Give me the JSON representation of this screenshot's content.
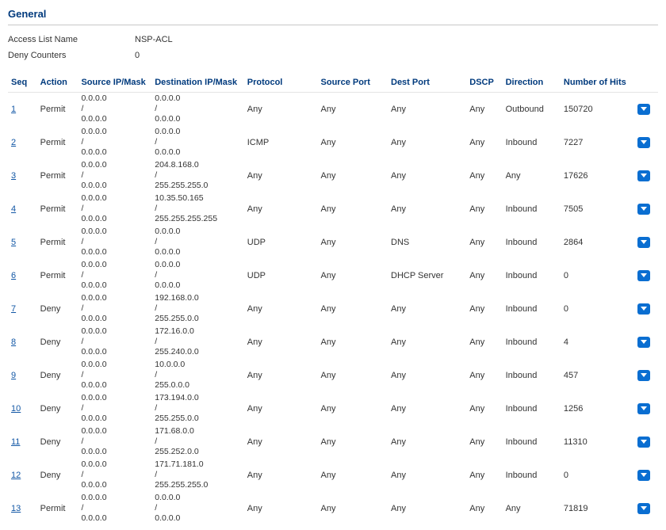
{
  "section_title": "General",
  "kv": {
    "name_label": "Access List Name",
    "name_value": "NSP-ACL",
    "deny_label": "Deny Counters",
    "deny_value": "0"
  },
  "columns": {
    "seq": "Seq",
    "action": "Action",
    "source_ip": "Source IP/Mask",
    "dest_ip": "Destination IP/Mask",
    "protocol": "Protocol",
    "source_port": "Source Port",
    "dest_port": "Dest Port",
    "dscp": "DSCP",
    "direction": "Direction",
    "hits": "Number of Hits"
  },
  "rows": [
    {
      "seq": "1",
      "action": "Permit",
      "sip_ip": "0.0.0.0",
      "sip_sep": "/",
      "sip_mask": "0.0.0.0",
      "dip_ip": "0.0.0.0",
      "dip_sep": "/",
      "dip_mask": "0.0.0.0",
      "protocol": "Any",
      "sport": "Any",
      "dport": "Any",
      "dscp": "Any",
      "direction": "Outbound",
      "hits": "150720"
    },
    {
      "seq": "2",
      "action": "Permit",
      "sip_ip": "0.0.0.0",
      "sip_sep": "/",
      "sip_mask": "0.0.0.0",
      "dip_ip": "0.0.0.0",
      "dip_sep": "/",
      "dip_mask": "0.0.0.0",
      "protocol": "ICMP",
      "sport": "Any",
      "dport": "Any",
      "dscp": "Any",
      "direction": "Inbound",
      "hits": "7227"
    },
    {
      "seq": "3",
      "action": "Permit",
      "sip_ip": "0.0.0.0",
      "sip_sep": "/",
      "sip_mask": "0.0.0.0",
      "dip_ip": "204.8.168.0",
      "dip_sep": "/",
      "dip_mask": "255.255.255.0",
      "protocol": "Any",
      "sport": "Any",
      "dport": "Any",
      "dscp": "Any",
      "direction": "Any",
      "hits": "17626"
    },
    {
      "seq": "4",
      "action": "Permit",
      "sip_ip": "0.0.0.0",
      "sip_sep": "/",
      "sip_mask": "0.0.0.0",
      "dip_ip": "10.35.50.165",
      "dip_sep": "/",
      "dip_mask": "255.255.255.255",
      "protocol": "Any",
      "sport": "Any",
      "dport": "Any",
      "dscp": "Any",
      "direction": "Inbound",
      "hits": "7505"
    },
    {
      "seq": "5",
      "action": "Permit",
      "sip_ip": "0.0.0.0",
      "sip_sep": "/",
      "sip_mask": "0.0.0.0",
      "dip_ip": "0.0.0.0",
      "dip_sep": "/",
      "dip_mask": "0.0.0.0",
      "protocol": "UDP",
      "sport": "Any",
      "dport": "DNS",
      "dscp": "Any",
      "direction": "Inbound",
      "hits": "2864"
    },
    {
      "seq": "6",
      "action": "Permit",
      "sip_ip": "0.0.0.0",
      "sip_sep": "/",
      "sip_mask": "0.0.0.0",
      "dip_ip": "0.0.0.0",
      "dip_sep": "/",
      "dip_mask": "0.0.0.0",
      "protocol": "UDP",
      "sport": "Any",
      "dport": "DHCP Server",
      "dscp": "Any",
      "direction": "Inbound",
      "hits": "0"
    },
    {
      "seq": "7",
      "action": "Deny",
      "sip_ip": "0.0.0.0",
      "sip_sep": "/",
      "sip_mask": "0.0.0.0",
      "dip_ip": "192.168.0.0",
      "dip_sep": "/",
      "dip_mask": "255.255.0.0",
      "protocol": "Any",
      "sport": "Any",
      "dport": "Any",
      "dscp": "Any",
      "direction": "Inbound",
      "hits": "0"
    },
    {
      "seq": "8",
      "action": "Deny",
      "sip_ip": "0.0.0.0",
      "sip_sep": "/",
      "sip_mask": "0.0.0.0",
      "dip_ip": "172.16.0.0",
      "dip_sep": "/",
      "dip_mask": "255.240.0.0",
      "protocol": "Any",
      "sport": "Any",
      "dport": "Any",
      "dscp": "Any",
      "direction": "Inbound",
      "hits": "4"
    },
    {
      "seq": "9",
      "action": "Deny",
      "sip_ip": "0.0.0.0",
      "sip_sep": "/",
      "sip_mask": "0.0.0.0",
      "dip_ip": "10.0.0.0",
      "dip_sep": "/",
      "dip_mask": "255.0.0.0",
      "protocol": "Any",
      "sport": "Any",
      "dport": "Any",
      "dscp": "Any",
      "direction": "Inbound",
      "hits": "457"
    },
    {
      "seq": "10",
      "action": "Deny",
      "sip_ip": "0.0.0.0",
      "sip_sep": "/",
      "sip_mask": "0.0.0.0",
      "dip_ip": "173.194.0.0",
      "dip_sep": "/",
      "dip_mask": "255.255.0.0",
      "protocol": "Any",
      "sport": "Any",
      "dport": "Any",
      "dscp": "Any",
      "direction": "Inbound",
      "hits": "1256"
    },
    {
      "seq": "11",
      "action": "Deny",
      "sip_ip": "0.0.0.0",
      "sip_sep": "/",
      "sip_mask": "0.0.0.0",
      "dip_ip": "171.68.0.0",
      "dip_sep": "/",
      "dip_mask": "255.252.0.0",
      "protocol": "Any",
      "sport": "Any",
      "dport": "Any",
      "dscp": "Any",
      "direction": "Inbound",
      "hits": "11310"
    },
    {
      "seq": "12",
      "action": "Deny",
      "sip_ip": "0.0.0.0",
      "sip_sep": "/",
      "sip_mask": "0.0.0.0",
      "dip_ip": "171.71.181.0",
      "dip_sep": "/",
      "dip_mask": "255.255.255.0",
      "protocol": "Any",
      "sport": "Any",
      "dport": "Any",
      "dscp": "Any",
      "direction": "Inbound",
      "hits": "0"
    },
    {
      "seq": "13",
      "action": "Permit",
      "sip_ip": "0.0.0.0",
      "sip_sep": "/",
      "sip_mask": "0.0.0.0",
      "dip_ip": "0.0.0.0",
      "dip_sep": "/",
      "dip_mask": "0.0.0.0",
      "protocol": "Any",
      "sport": "Any",
      "dport": "Any",
      "dscp": "Any",
      "direction": "Any",
      "hits": "71819"
    }
  ]
}
